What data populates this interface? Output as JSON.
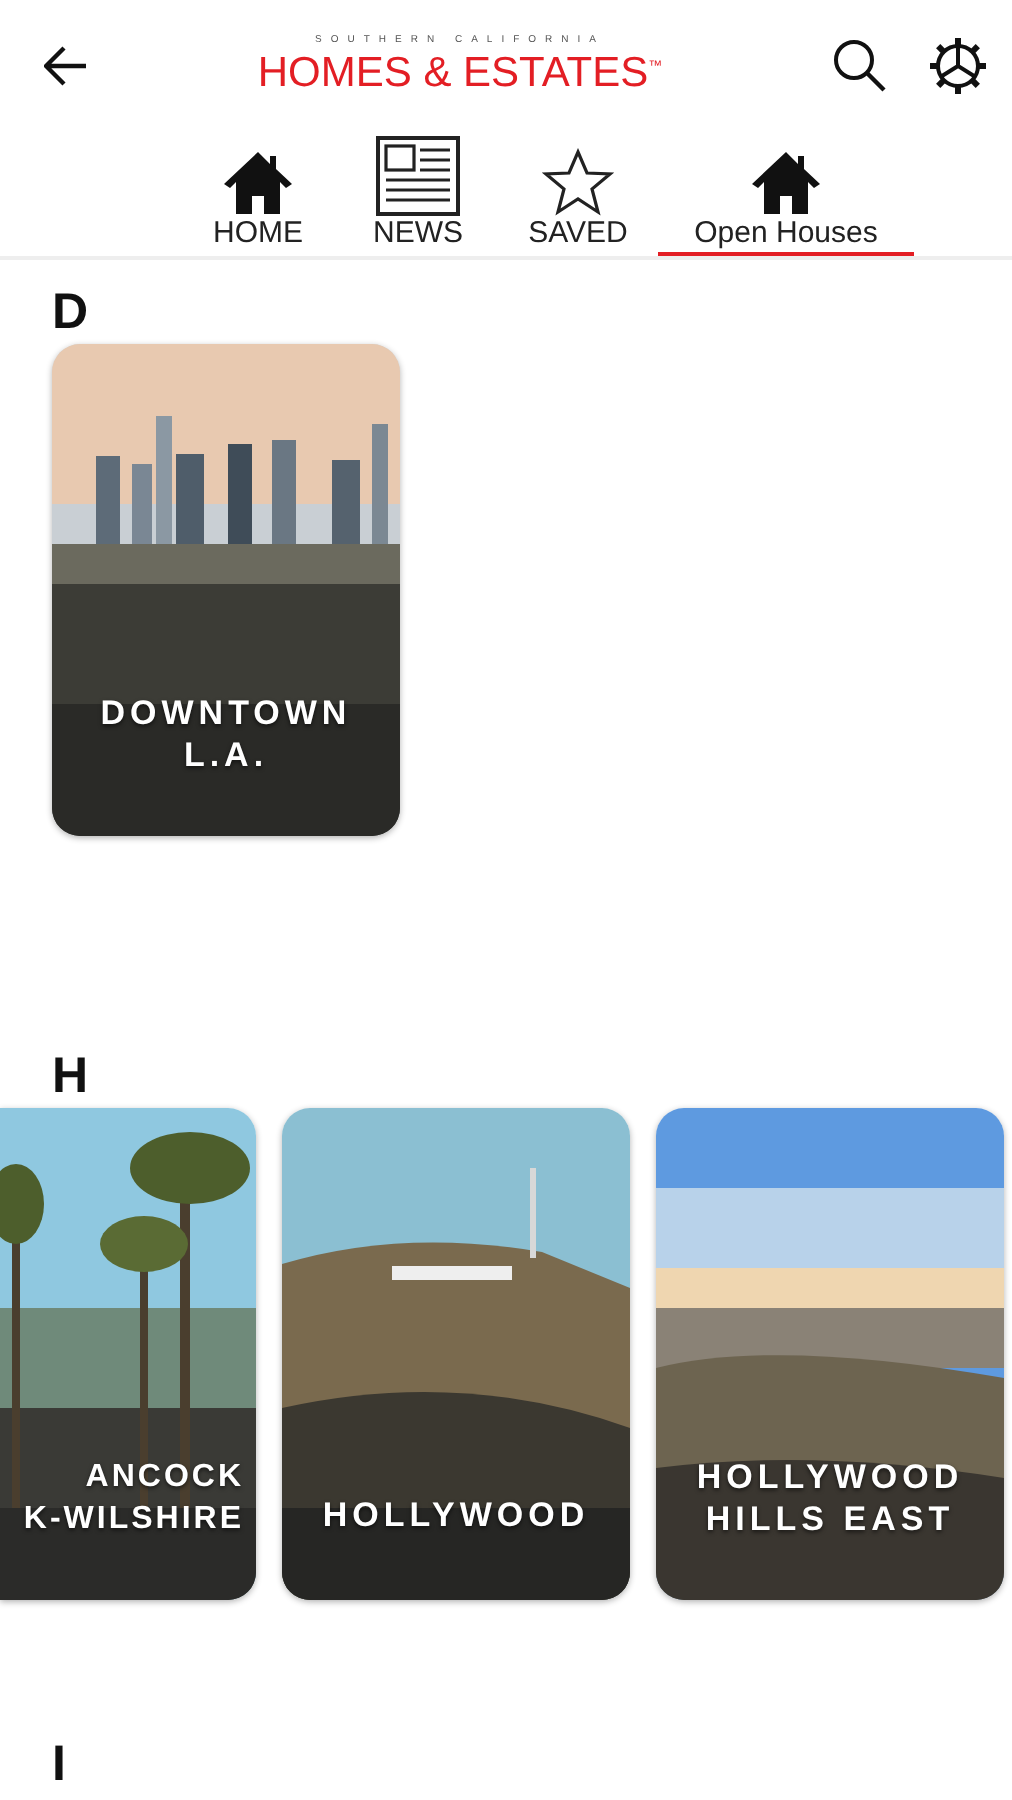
{
  "header": {
    "logo": {
      "tagline": "SOUTHERN CALIFORNIA",
      "name": "HOMES & ESTATES",
      "mark": "™"
    }
  },
  "tabs": [
    {
      "label": "HOME",
      "kind": "home",
      "selected": false
    },
    {
      "label": "NEWS",
      "kind": "news",
      "selected": false
    },
    {
      "label": "SAVED",
      "kind": "star",
      "selected": false
    },
    {
      "label": "Open Houses",
      "kind": "home",
      "selected": true
    }
  ],
  "sections": [
    {
      "letter": "D",
      "cards": [
        {
          "kind": "full",
          "lines": [
            "DOWNTOWN",
            "L.A."
          ]
        }
      ]
    },
    {
      "letter": "H",
      "cards": [
        {
          "kind": "partial",
          "lines": [
            "ANCOCK",
            "K-WILSHIRE"
          ]
        },
        {
          "kind": "full",
          "lines": [
            "HOLLYWOOD"
          ]
        },
        {
          "kind": "full",
          "lines": [
            "HOLLYWOOD",
            "HILLS EAST"
          ]
        }
      ]
    },
    {
      "letter": "I"
    }
  ]
}
